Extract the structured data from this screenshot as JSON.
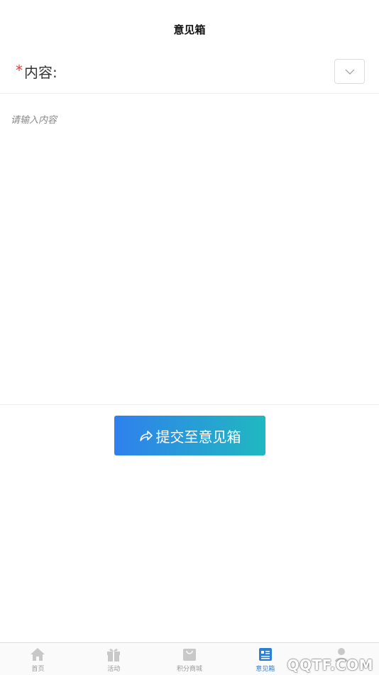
{
  "header": {
    "title": "意见箱"
  },
  "form": {
    "required_mark": "*",
    "content_label": "内容:",
    "content_placeholder": "请输入内容",
    "content_value": ""
  },
  "submit": {
    "label": "提交至意见箱",
    "icon": "share-arrow-icon"
  },
  "tabbar": {
    "active_color": "#2d7fd6",
    "inactive_color": "#c8c8c8",
    "tabs": [
      {
        "label": "首页",
        "icon": "home-icon",
        "active": false
      },
      {
        "label": "活动",
        "icon": "gift-icon",
        "active": false
      },
      {
        "label": "积分商城",
        "icon": "shopping-bag-icon",
        "active": false
      },
      {
        "label": "意见箱",
        "icon": "suggestion-box-icon",
        "active": true
      },
      {
        "label": "",
        "icon": "user-icon",
        "active": false
      }
    ]
  },
  "watermark": "QQTF.COM",
  "colors": {
    "accent_start": "#2f80ed",
    "accent_end": "#20b8c0",
    "required": "#e03b3b"
  }
}
